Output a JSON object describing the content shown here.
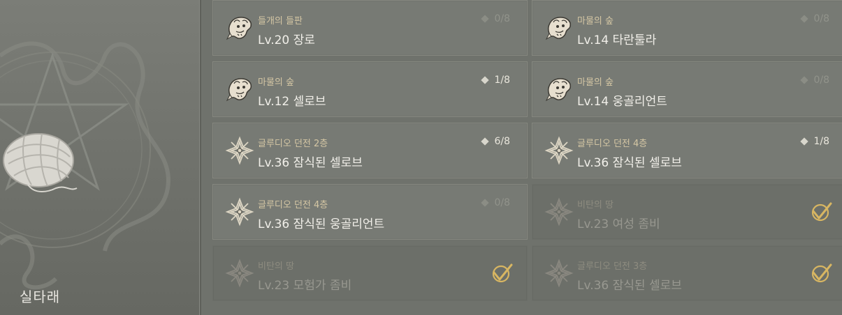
{
  "item": {
    "name": "실타래"
  },
  "quests": [
    {
      "region": "들개의 들판",
      "title": "Lv.20 장로",
      "progress": "0/8",
      "icon": "beast-head-icon",
      "completed": false
    },
    {
      "region": "마물의 숲",
      "title": "Lv.14 타란툴라",
      "progress": "0/8",
      "icon": "beast-head-icon",
      "completed": false
    },
    {
      "region": "마물의 숲",
      "title": "Lv.12 셀로브",
      "progress": "1/8",
      "icon": "beast-head-icon",
      "completed": false
    },
    {
      "region": "마물의 숲",
      "title": "Lv.14 웅골리언트",
      "progress": "0/8",
      "icon": "beast-head-icon",
      "completed": false
    },
    {
      "region": "글루디오 던전 2층",
      "title": "Lv.36 잠식된 셀로브",
      "progress": "6/8",
      "icon": "dungeon-emblem-icon",
      "completed": false
    },
    {
      "region": "글루디오 던전 4층",
      "title": "Lv.36 잠식된 셀로브",
      "progress": "1/8",
      "icon": "dungeon-emblem-icon",
      "completed": false
    },
    {
      "region": "글루디오 던전 4층",
      "title": "Lv.36 잠식된 웅골리언트",
      "progress": "0/8",
      "icon": "dungeon-emblem-icon",
      "completed": false
    },
    {
      "region": "비탄의 땅",
      "title": "Lv.23 여성 좀비",
      "progress": "",
      "icon": "dungeon-emblem-icon",
      "completed": true
    },
    {
      "region": "비탄의 땅",
      "title": "Lv.23 모험가 좀비",
      "progress": "",
      "icon": "dungeon-emblem-icon",
      "completed": true
    },
    {
      "region": "글루디오 던전 3층",
      "title": "Lv.36 잠식된 셀로브",
      "progress": "",
      "icon": "dungeon-emblem-icon",
      "completed": true
    }
  ],
  "colors": {
    "accent_gold": "#d8b662",
    "region_text": "#d4c6a4"
  }
}
